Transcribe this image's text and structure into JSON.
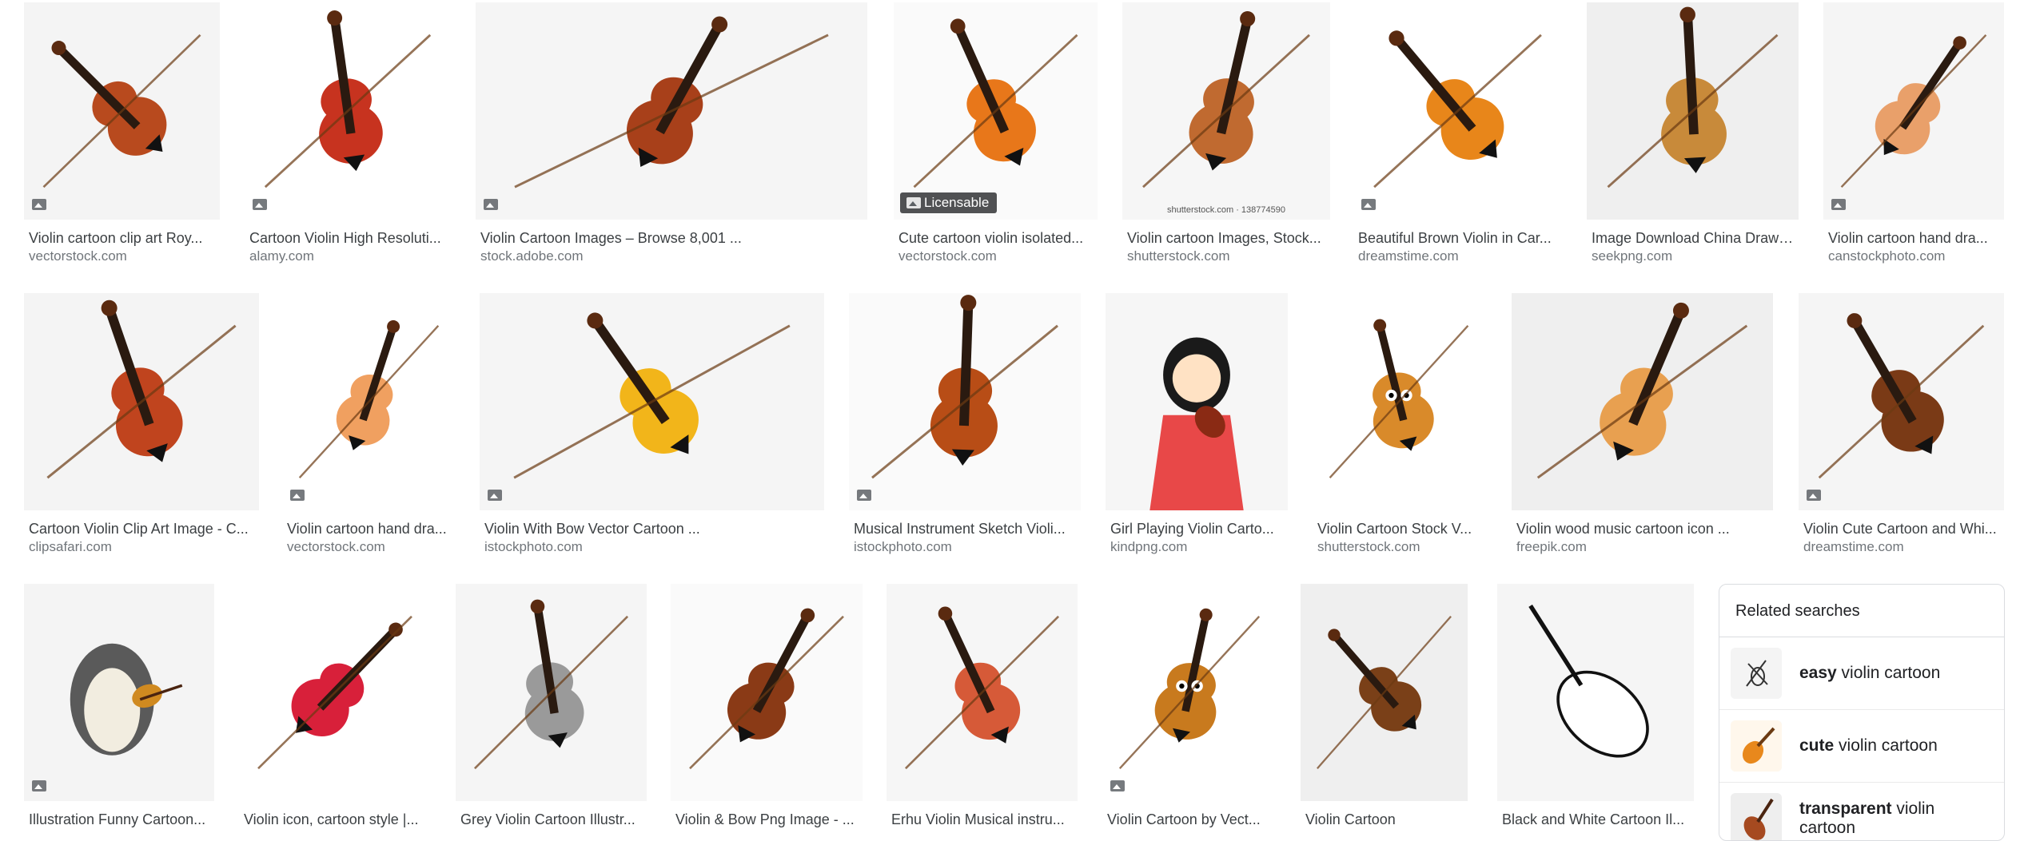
{
  "colors": {
    "title_text": "#3c4043",
    "source_text": "#70757a",
    "thumb_bg": "#f1f3f4",
    "violin_brown": "#a0401d",
    "violin_orange": "#e77a18",
    "violin_yellow": "#f3b416"
  },
  "results": [
    {
      "title": "Violin cartoon clip art Roy...",
      "source": "vectorstock.com",
      "icon": "violin-image",
      "badge": true
    },
    {
      "title": "Cartoon Violin High Resoluti...",
      "source": "alamy.com",
      "icon": "violin-image",
      "badge": true
    },
    {
      "title": "Violin Cartoon Images – Browse 8,001 ...",
      "source": "stock.adobe.com",
      "icon": "violin-image",
      "badge": true
    },
    {
      "title": "Cute cartoon violin isolated...",
      "source": "vectorstock.com",
      "icon": "violin-image",
      "licensable": "Licensable"
    },
    {
      "title": "Violin cartoon Images, Stock...",
      "source": "shutterstock.com",
      "icon": "violin-image",
      "watermark": "shutterstock.com · 138774590"
    },
    {
      "title": "Beautiful Brown Violin in Car...",
      "source": "dreamstime.com",
      "icon": "violin-image",
      "badge": true
    },
    {
      "title": "Image Download China Drawi...",
      "source": "seekpng.com",
      "icon": "violin-image"
    },
    {
      "title": "Violin cartoon hand dra...",
      "source": "canstockphoto.com",
      "icon": "violin-image",
      "badge": true
    },
    {
      "title": "Cartoon Violin Clip Art Image - C...",
      "source": "clipsafari.com",
      "icon": "violin-image"
    },
    {
      "title": "Violin cartoon hand dra...",
      "source": "vectorstock.com",
      "icon": "violin-image",
      "badge": true
    },
    {
      "title": "Violin With Bow Vector Cartoon ...",
      "source": "istockphoto.com",
      "icon": "violin-image",
      "badge": true
    },
    {
      "title": "Musical Instrument Sketch Violi...",
      "source": "istockphoto.com",
      "icon": "violin-image",
      "badge": true
    },
    {
      "title": "Girl Playing Violin Carto...",
      "source": "kindpng.com",
      "icon": "girl-violin-image"
    },
    {
      "title": "Violin Cartoon Stock V...",
      "source": "shutterstock.com",
      "icon": "violin-character-image"
    },
    {
      "title": "Violin wood music cartoon icon ...",
      "source": "freepik.com",
      "icon": "violin-image"
    },
    {
      "title": "Violin Cute Cartoon and Whi...",
      "source": "dreamstime.com",
      "icon": "violin-image",
      "badge": true
    },
    {
      "title": "Illustration Funny Cartoon...",
      "source": "",
      "icon": "penguin-violin-image",
      "badge": true
    },
    {
      "title": "Violin icon, cartoon style |...",
      "source": "",
      "icon": "violin-image"
    },
    {
      "title": "Grey Violin Cartoon Illustr...",
      "source": "",
      "icon": "violin-image"
    },
    {
      "title": "Violin & Bow Png Image - ...",
      "source": "",
      "icon": "violin-image"
    },
    {
      "title": "Erhu Violin Musical instru...",
      "source": "",
      "icon": "violin-image"
    },
    {
      "title": "Violin Cartoon by Vect...",
      "source": "",
      "icon": "violin-character-image",
      "badge": true
    },
    {
      "title": "Violin Cartoon",
      "source": "",
      "icon": "violin-image"
    },
    {
      "title": "Black and White Cartoon Il...",
      "source": "",
      "icon": "violin-outline-image"
    }
  ],
  "related": {
    "heading": "Related searches",
    "items": [
      {
        "bold": "easy",
        "rest": " violin cartoon",
        "icon": "violin-sketch-icon"
      },
      {
        "bold": "cute",
        "rest": " violin cartoon",
        "icon": "cute-violin-icon"
      },
      {
        "bold": "transparent",
        "rest": " violin cartoon",
        "icon": "transparent-violin-icon"
      }
    ]
  }
}
